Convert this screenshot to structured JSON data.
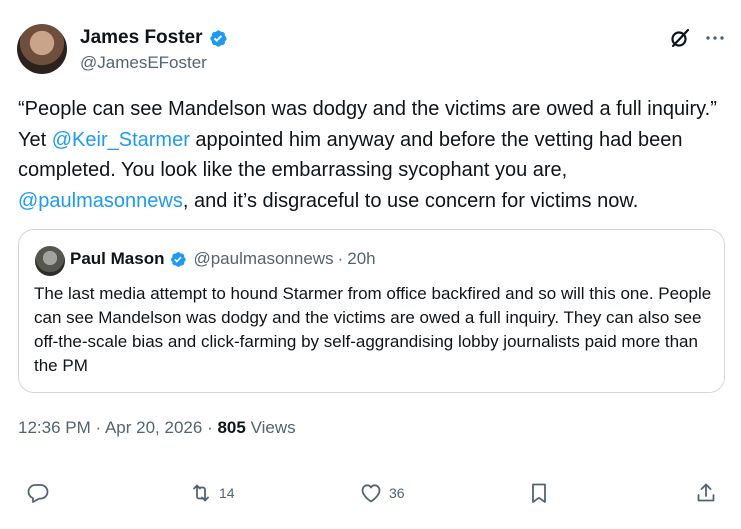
{
  "author": {
    "name": "James Foster",
    "handle": "@JamesEFoster"
  },
  "tweet": {
    "text_1": "“People can see Mandelson was dodgy and the victims are owed a full inquiry.” Yet ",
    "mention_1": "@Keir_Starmer",
    "text_2": " appointed him anyway and before the vetting had been completed. You look like the embarrassing sycophant you are, ",
    "mention_2": "@paulmasonnews",
    "text_3": ", and it’s disgraceful to use concern for victims now."
  },
  "quote": {
    "name": "Paul Mason",
    "handle": "@paulmasonnews",
    "separator": "·",
    "time": "20h",
    "text": "The last media attempt to hound Starmer from office backfired and so will this one. People can see Mandelson was dodgy and the victims are owed a full inquiry. They can also see off-the-scale bias and click-farming by self-aggrandising lobby journalists paid more than the PM"
  },
  "meta": {
    "time": "12:36 PM",
    "separator": "·",
    "date": "Apr 20, 2026",
    "views_count": "805",
    "views_label": "Views"
  },
  "actions": {
    "reposts": "14",
    "likes": "36"
  },
  "colors": {
    "accent": "#1d9bf0",
    "secondary_text": "#536471",
    "border": "#cfd9de"
  }
}
